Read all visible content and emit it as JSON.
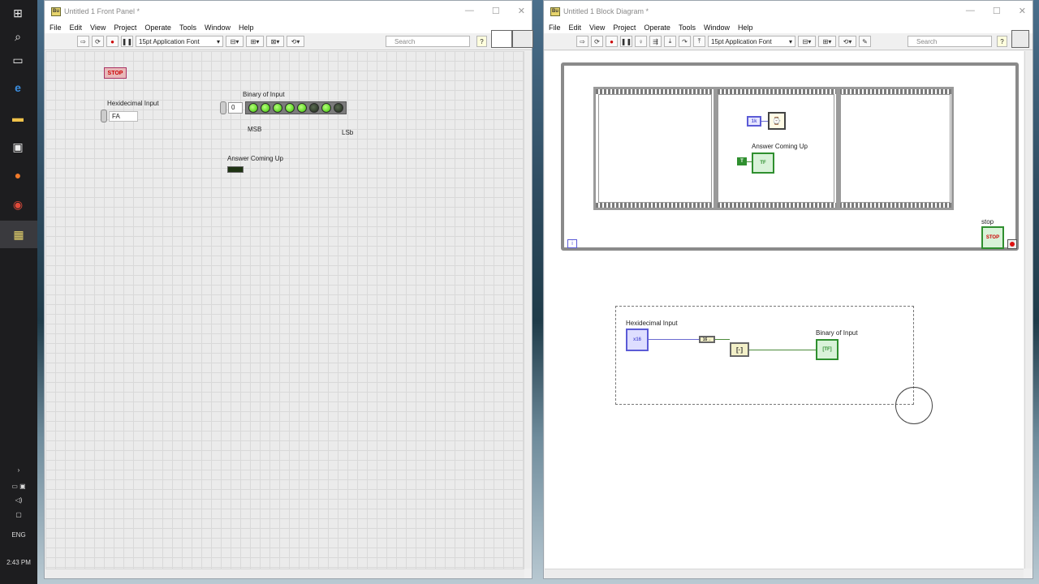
{
  "taskbar": {
    "clock": "2:43 PM",
    "language": "ENG",
    "icons": [
      "windows-start-icon",
      "search-icon",
      "task-view-icon",
      "edge-icon",
      "file-explorer-icon",
      "store-icon",
      "firefox-icon",
      "chrome-icon",
      "labview-icon"
    ]
  },
  "front_panel": {
    "title": "Untitled 1 Front Panel *",
    "menu": [
      "File",
      "Edit",
      "View",
      "Project",
      "Operate",
      "Tools",
      "Window",
      "Help"
    ],
    "font": "15pt Application Font",
    "search_placeholder": "Search",
    "help": "?",
    "stop_label": "STOP",
    "hex_label": "Hexidecimal Input",
    "hex_value": "FA",
    "binary_label": "Binary of Input",
    "array_index": "0",
    "leds": [
      true,
      true,
      true,
      true,
      true,
      false,
      true,
      false
    ],
    "msb": "MSB",
    "lsb": "LSb",
    "answer_label": "Answer Coming Up"
  },
  "block_diagram": {
    "title": "Untitled 1 Block Diagram *",
    "menu": [
      "File",
      "Edit",
      "View",
      "Project",
      "Operate",
      "Tools",
      "Window",
      "Help"
    ],
    "font": "15pt Application Font",
    "search_placeholder": "Search",
    "help": "?",
    "answer_label": "Answer Coming Up",
    "stop_label": "stop",
    "hex_label": "Hexidecimal Input",
    "binary_label": "Binary of Input",
    "iteration": "i"
  }
}
